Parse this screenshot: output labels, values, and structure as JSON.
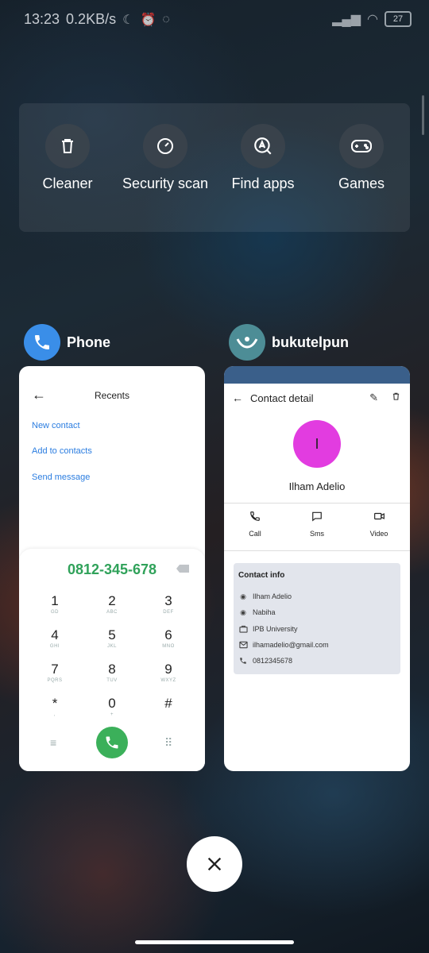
{
  "status_bar": {
    "time": "13:23",
    "speed": "0.2KB/s",
    "battery": "27"
  },
  "quick_actions": [
    {
      "label": "Cleaner",
      "icon": "trash-icon"
    },
    {
      "label": "Security scan",
      "icon": "security-gauge-icon"
    },
    {
      "label": "Find apps",
      "icon": "find-apps-icon"
    },
    {
      "label": "Games",
      "icon": "gamepad-icon"
    }
  ],
  "phone_app": {
    "name": "Phone",
    "recents_title": "Recents",
    "links": [
      "New contact",
      "Add to contacts",
      "Send message"
    ],
    "dial_number": "0812-345-678",
    "keys": [
      {
        "digit": "1",
        "letters": "GD"
      },
      {
        "digit": "2",
        "letters": "ABC"
      },
      {
        "digit": "3",
        "letters": "DEF"
      },
      {
        "digit": "4",
        "letters": "GHI"
      },
      {
        "digit": "5",
        "letters": "JKL"
      },
      {
        "digit": "6",
        "letters": "MNO"
      },
      {
        "digit": "7",
        "letters": "PQRS"
      },
      {
        "digit": "8",
        "letters": "TUV"
      },
      {
        "digit": "9",
        "letters": "WXYZ"
      },
      {
        "digit": "*",
        "letters": ","
      },
      {
        "digit": "0",
        "letters": "+"
      },
      {
        "digit": "#",
        "letters": ""
      }
    ]
  },
  "contact_app": {
    "name": "bukutelpun",
    "header_title": "Contact detail",
    "avatar_initial": "I",
    "contact_name": "Ilham Adelio",
    "actions": [
      {
        "label": "Call",
        "icon": "phone-icon"
      },
      {
        "label": "Sms",
        "icon": "sms-icon"
      },
      {
        "label": "Video",
        "icon": "video-icon"
      }
    ],
    "info_title": "Contact info",
    "info": [
      {
        "icon": "person-icon",
        "text": "Ilham Adelio"
      },
      {
        "icon": "person-icon",
        "text": "Nabiha"
      },
      {
        "icon": "briefcase-icon",
        "text": "IPB University"
      },
      {
        "icon": "email-icon",
        "text": "ilhamadelio@gmail.com"
      },
      {
        "icon": "phone-icon",
        "text": "0812345678"
      }
    ]
  },
  "colors": {
    "dial_green": "#30a25a",
    "link_blue": "#2b7de0",
    "avatar_magenta": "#e23ce0",
    "contact_topbar": "#3a5f8a"
  }
}
